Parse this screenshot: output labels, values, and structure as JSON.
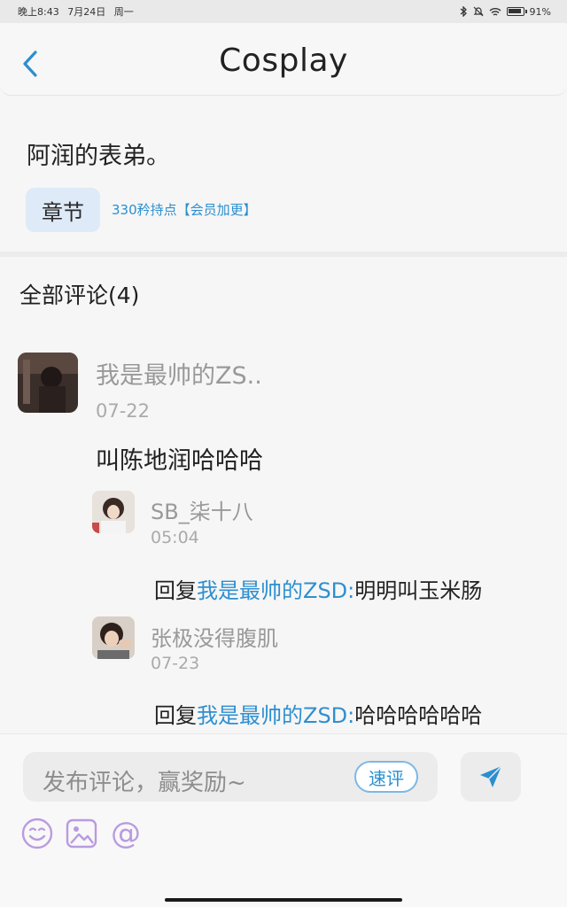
{
  "status_bar": {
    "time": "晚上8:43",
    "date": "7月24日",
    "weekday": "周一",
    "battery": "91%"
  },
  "header": {
    "title": "Cosplay",
    "back_icon": "chevron-left-icon"
  },
  "book": {
    "title": "阿润的表弟。",
    "chapter_tag": "章节",
    "chapter_note": "330矜持点【会员加更】"
  },
  "comments": {
    "title": "全部评论(4)",
    "items": [
      {
        "user": "我是最帅的ZS..",
        "date": "07-22",
        "text": "叫陈地润哈哈哈"
      }
    ],
    "replies": [
      {
        "user": "SB_柒十八",
        "date": "05:04",
        "prefix": "回复",
        "target": "我是最帅的ZSD:",
        "text": "明明叫玉米肠"
      },
      {
        "user": "张极没得腹肌",
        "date": "07-23",
        "prefix": "回复",
        "target": "我是最帅的ZSD:",
        "text": "哈哈哈哈哈哈"
      }
    ]
  },
  "composer": {
    "placeholder": "发布评论，赢奖励~",
    "quick_label": "速评",
    "send_icon": "send-icon",
    "tools": [
      "emoji-icon",
      "image-icon",
      "mention-icon"
    ]
  },
  "colors": {
    "accent": "#2b8fcf",
    "tag_bg": "#deeaf7",
    "tool_icon": "#b99be0"
  }
}
